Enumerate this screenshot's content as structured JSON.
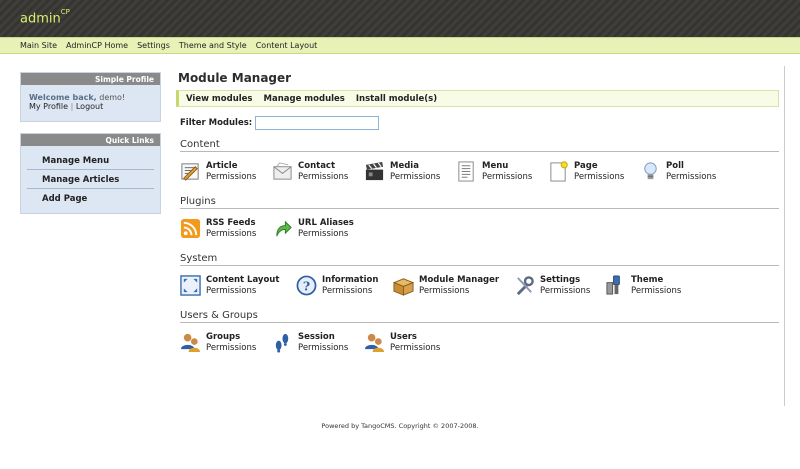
{
  "header": {
    "logo_main": "admin",
    "logo_sup": "CP"
  },
  "topnav": [
    "Main Site",
    "AdminCP Home",
    "Settings",
    "Theme and Style",
    "Content Layout"
  ],
  "sidebar": {
    "profile": {
      "title": "Simple Profile",
      "welcome_prefix": "Welcome back,",
      "username": "demo!",
      "my_profile": "My Profile",
      "separator": "|",
      "logout": "Logout"
    },
    "quick_links": {
      "title": "Quick Links",
      "items": [
        "Manage Menu",
        "Manage Articles",
        "Add Page"
      ]
    }
  },
  "main": {
    "title": "Module Manager",
    "subnav": [
      "View modules",
      "Manage modules",
      "Install module(s)"
    ],
    "filter_label": "Filter Modules:",
    "filter_value": "",
    "sections": [
      {
        "title": "Content",
        "items": [
          {
            "name": "Article",
            "perm": "Permissions",
            "icon": "article-icon"
          },
          {
            "name": "Contact",
            "perm": "Permissions",
            "icon": "contact-icon"
          },
          {
            "name": "Media",
            "perm": "Permissions",
            "icon": "media-icon"
          },
          {
            "name": "Menu",
            "perm": "Permissions",
            "icon": "menu-icon"
          },
          {
            "name": "Page",
            "perm": "Permissions",
            "icon": "page-icon"
          },
          {
            "name": "Poll",
            "perm": "Permissions",
            "icon": "poll-icon"
          }
        ]
      },
      {
        "title": "Plugins",
        "items": [
          {
            "name": "RSS Feeds",
            "perm": "Permissions",
            "icon": "rss-icon"
          },
          {
            "name": "URL Aliases",
            "perm": "Permissions",
            "icon": "url-alias-icon"
          }
        ]
      },
      {
        "title": "System",
        "items": [
          {
            "name": "Content Layout",
            "perm": "Permissions",
            "icon": "content-layout-icon"
          },
          {
            "name": "Information",
            "perm": "Permissions",
            "icon": "information-icon"
          },
          {
            "name": "Module Manager",
            "perm": "Permissions",
            "icon": "module-manager-icon"
          },
          {
            "name": "Settings",
            "perm": "Permissions",
            "icon": "settings-icon"
          },
          {
            "name": "Theme",
            "perm": "Permissions",
            "icon": "theme-icon"
          }
        ]
      },
      {
        "title": "Users & Groups",
        "items": [
          {
            "name": "Groups",
            "perm": "Permissions",
            "icon": "groups-icon"
          },
          {
            "name": "Session",
            "perm": "Permissions",
            "icon": "session-icon"
          },
          {
            "name": "Users",
            "perm": "Permissions",
            "icon": "users-icon"
          }
        ]
      }
    ]
  },
  "footer": "Powered by TangoCMS. Copyright © 2007-2008."
}
